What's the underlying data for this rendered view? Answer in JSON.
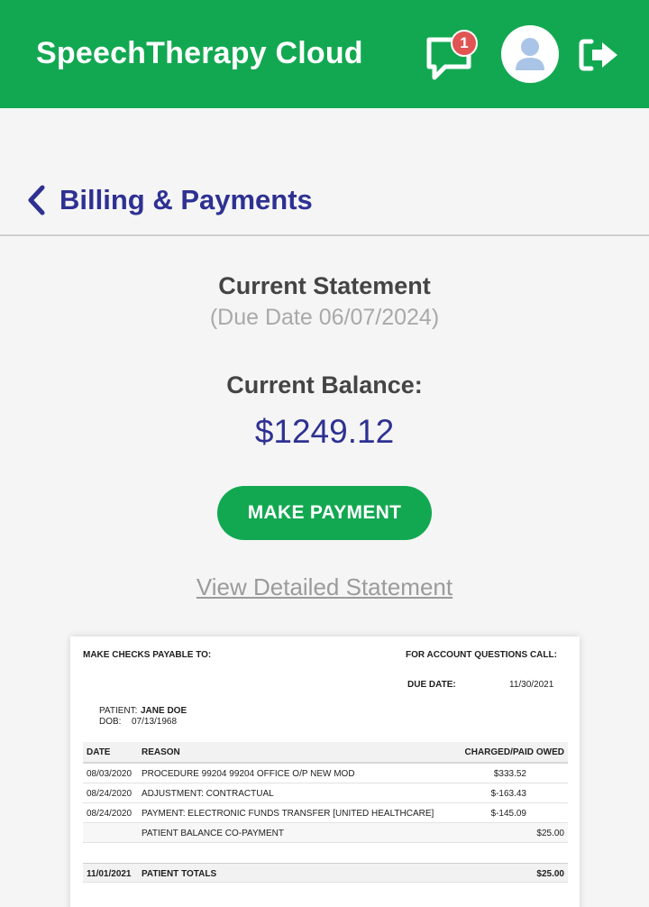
{
  "header": {
    "app_title": "SpeechTherapy Cloud",
    "message_badge": "1",
    "icons": [
      "message-icon",
      "user-avatar-icon",
      "logout-icon"
    ]
  },
  "nav": {
    "page_title": "Billing & Payments"
  },
  "summary": {
    "statement_title": "Current Statement",
    "due_date_text": "(Due Date 06/07/2024)",
    "balance_label": "Current Balance:",
    "balance_value": "$1249.12",
    "pay_button": "MAKE PAYMENT",
    "detail_link": "View Detailed Statement"
  },
  "statement": {
    "payable_to_label": "MAKE CHECKS PAYABLE TO:",
    "questions_label": "FOR ACCOUNT QUESTIONS CALL:",
    "due_date_label": "DUE DATE:",
    "due_date_value": "11/30/2021",
    "patient_label": "PATIENT:",
    "patient_name": "JANE DOE",
    "dob_label": "DOB:",
    "dob_value": "07/13/1968",
    "columns": [
      "DATE",
      "REASON",
      "CHARGED/PAID",
      "OWED"
    ],
    "rows": [
      {
        "date": "08/03/2020",
        "reason": "PROCEDURE 99204 99204 OFFICE O/P NEW MOD",
        "charged": "$333.52",
        "owed": ""
      },
      {
        "date": "08/24/2020",
        "reason": "ADJUSTMENT: CONTRACTUAL",
        "charged": "$-163.43",
        "owed": ""
      },
      {
        "date": "08/24/2020",
        "reason": "PAYMENT: ELECTRONIC FUNDS TRANSFER [UNITED HEALTHCARE]",
        "charged": "$-145.09",
        "owed": ""
      },
      {
        "date": "",
        "reason": "PATIENT BALANCE CO-PAYMENT",
        "charged": "",
        "owed": "$25.00"
      }
    ],
    "total": {
      "date": "11/01/2021",
      "reason": "PATIENT TOTALS",
      "charged": "",
      "owed": "$25.00"
    }
  },
  "colors": {
    "brand_green": "#12a851",
    "navy": "#2e3192",
    "badge_red": "#e05553"
  }
}
